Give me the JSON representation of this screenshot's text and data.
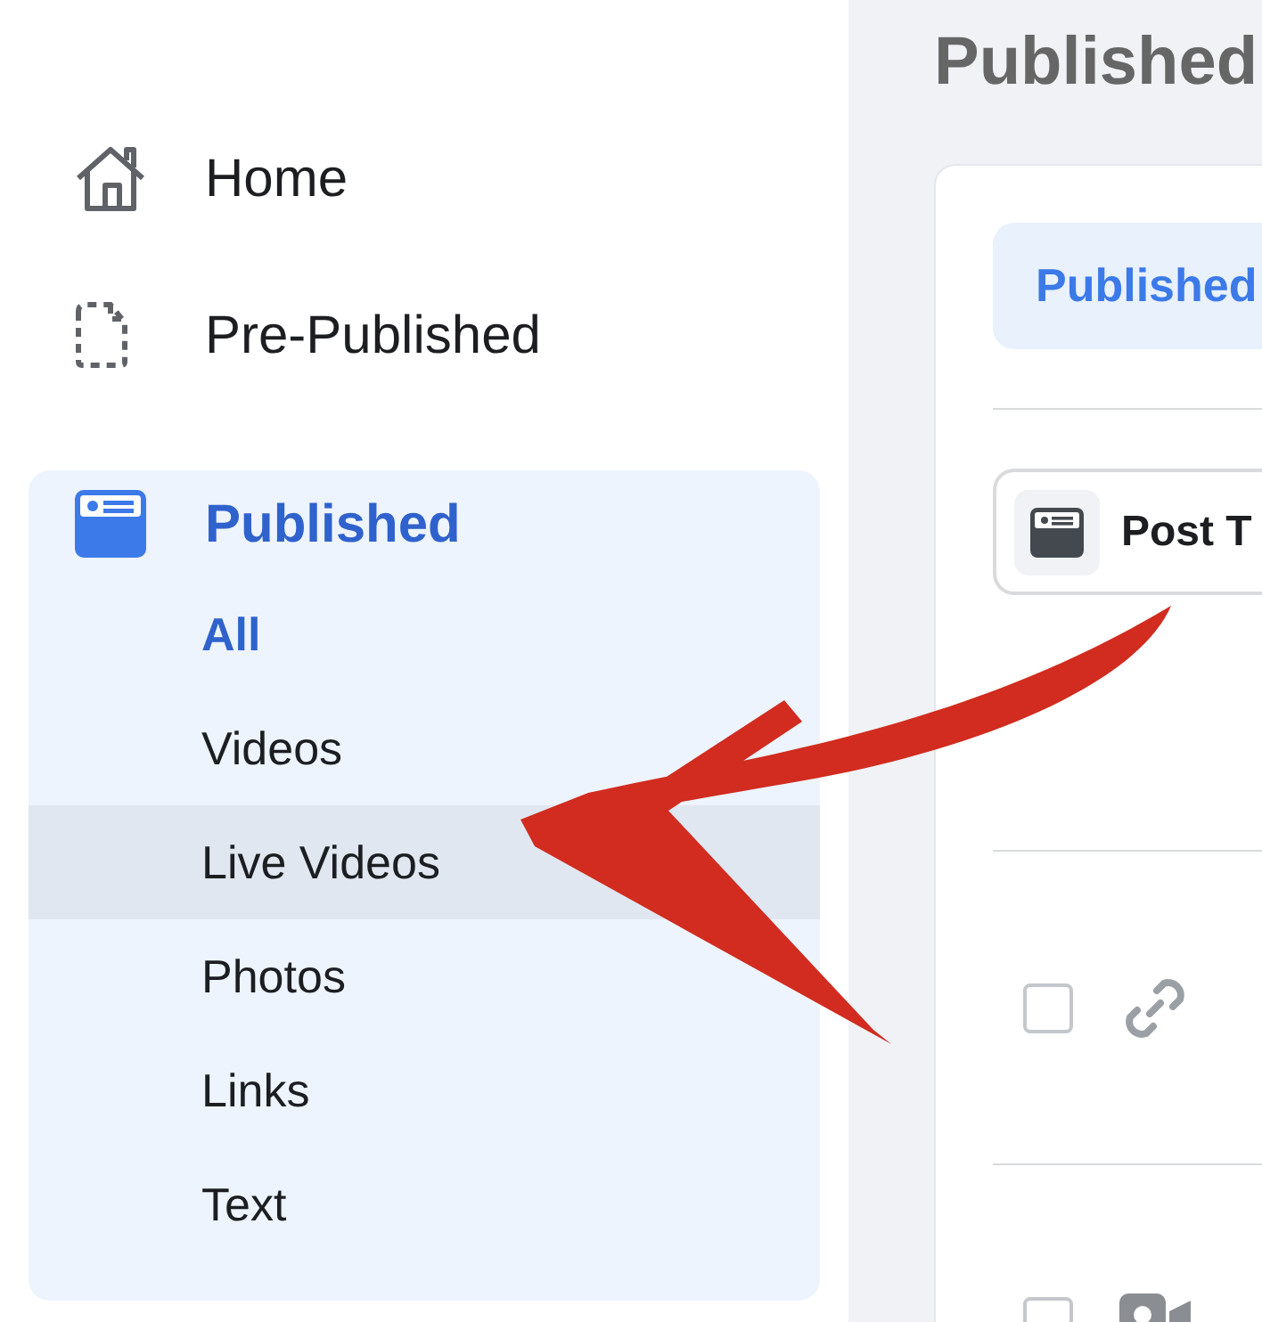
{
  "sidebar": {
    "items": [
      {
        "label": "Home",
        "kind": "home",
        "selected": false
      },
      {
        "label": "Pre-Published",
        "kind": "draft",
        "selected": false
      },
      {
        "label": "Published",
        "kind": "card",
        "selected": true,
        "children": [
          {
            "label": "All",
            "selected": true,
            "hovered": false
          },
          {
            "label": "Videos",
            "selected": false,
            "hovered": false
          },
          {
            "label": "Live Videos",
            "selected": false,
            "hovered": true
          },
          {
            "label": "Photos",
            "selected": false,
            "hovered": false
          },
          {
            "label": "Links",
            "selected": false,
            "hovered": false
          },
          {
            "label": "Text",
            "selected": false,
            "hovered": false
          }
        ]
      }
    ]
  },
  "main": {
    "title": "Published",
    "tabs": [
      {
        "label": "Published",
        "selected": true
      }
    ],
    "filter": {
      "label": "Post T"
    },
    "rows": [
      {
        "kind": "link",
        "checked": false
      },
      {
        "kind": "video",
        "checked": false
      }
    ]
  }
}
